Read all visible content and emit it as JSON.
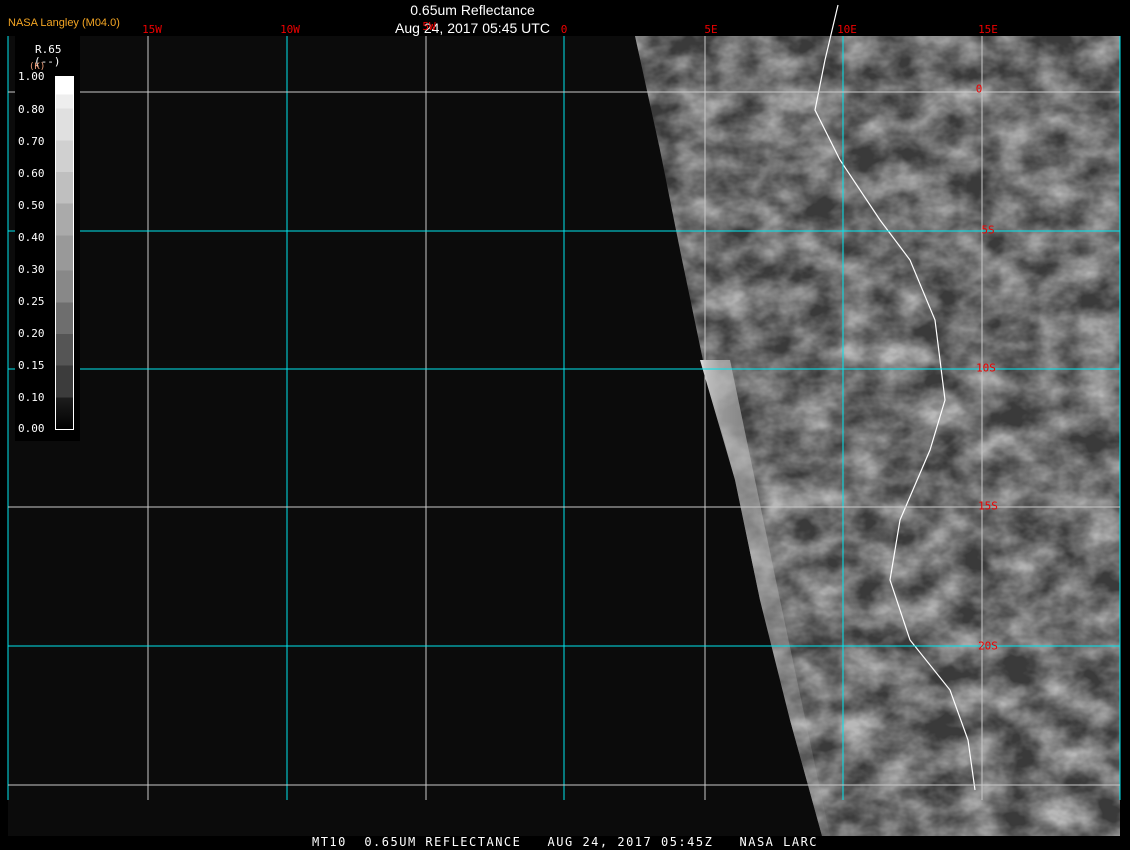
{
  "header": {
    "title": "0.65um Reflectance",
    "subtitle": "Aug 24, 2017 05:45 UTC",
    "brand": "NASA Langley (M04.0)"
  },
  "footer": {
    "caption": "MT10  0.65UM REFLECTANCE   AUG 24, 2017 05:45Z   NASA LARC"
  },
  "legend": {
    "title": "R.65",
    "units": "(--)",
    "units_alt": "(K)",
    "labels": [
      "1.00",
      "0.80",
      "0.70",
      "0.60",
      "0.50",
      "0.40",
      "0.30",
      "0.25",
      "0.20",
      "0.15",
      "0.10",
      "0.00"
    ]
  },
  "longitudes": [
    "15W",
    "10W",
    "5W",
    "0",
    "5E",
    "10E",
    "15E"
  ],
  "latitudes": [
    "0",
    "5S",
    "10S",
    "15S",
    "20S"
  ],
  "colors": {
    "grid_cyan": "#00e5ee",
    "grid_white": "#c8c8c8",
    "label_red": "#e00000",
    "brand": "#f5a623",
    "space": "#0b0b0b"
  }
}
